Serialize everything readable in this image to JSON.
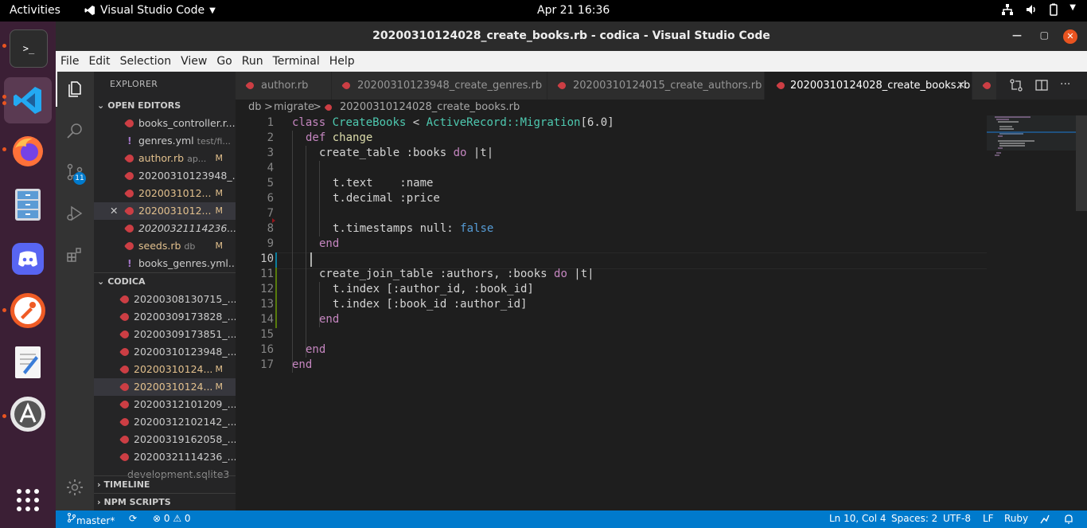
{
  "topbar": {
    "activities": "Activities",
    "app_name": "Visual Studio Code",
    "clock": "Apr 21  16:36"
  },
  "window": {
    "title": "20200310124028_create_books.rb - codica - Visual Studio Code"
  },
  "menu": [
    "File",
    "Edit",
    "Selection",
    "View",
    "Go",
    "Run",
    "Terminal",
    "Help"
  ],
  "activity": {
    "scm_badge": "11"
  },
  "sidebar": {
    "title": "EXPLORER",
    "open_editors_header": "OPEN EDITORS",
    "open_editors": [
      {
        "name": "books_controller.r...",
        "desc": "",
        "mod": "",
        "icon": "ruby",
        "style": ""
      },
      {
        "name": "genres.yml",
        "desc": "test/fi...",
        "mod": "",
        "icon": "yml",
        "style": ""
      },
      {
        "name": "author.rb",
        "desc": "ap...",
        "mod": "M",
        "icon": "ruby",
        "style": "mod"
      },
      {
        "name": "20200310123948_...",
        "desc": "",
        "mod": "",
        "icon": "ruby",
        "style": ""
      },
      {
        "name": "2020031012...",
        "desc": "",
        "mod": "M",
        "icon": "ruby",
        "style": "mod"
      },
      {
        "name": "2020031012...",
        "desc": "",
        "mod": "M",
        "icon": "ruby",
        "style": "mod",
        "selected": true,
        "close": "✕"
      },
      {
        "name": "20200321114236...",
        "desc": "",
        "mod": "",
        "icon": "ruby",
        "style": "ital"
      },
      {
        "name": "seeds.rb",
        "desc": "db",
        "mod": "M",
        "icon": "ruby",
        "style": "mod"
      },
      {
        "name": "books_genres.yml...",
        "desc": "",
        "mod": "",
        "icon": "yml",
        "style": ""
      }
    ],
    "codica_header": "CODICA",
    "codica_files": [
      {
        "name": "20200308130715_...",
        "mod": "",
        "style": ""
      },
      {
        "name": "20200309173828_...",
        "mod": "",
        "style": ""
      },
      {
        "name": "20200309173851_...",
        "mod": "",
        "style": ""
      },
      {
        "name": "20200310123948_...",
        "mod": "",
        "style": ""
      },
      {
        "name": "20200310124...",
        "mod": "M",
        "style": "mod"
      },
      {
        "name": "20200310124...",
        "mod": "M",
        "style": "mod",
        "selected": true
      },
      {
        "name": "20200312101209_...",
        "mod": "",
        "style": ""
      },
      {
        "name": "20200312102142_...",
        "mod": "",
        "style": ""
      },
      {
        "name": "20200319162058_...",
        "mod": "",
        "style": ""
      },
      {
        "name": "20200321114236_...",
        "mod": "",
        "style": ""
      },
      {
        "name": "development.sqlite3",
        "mod": "",
        "style": "dimmed"
      }
    ],
    "timeline_header": "TIMELINE",
    "npm_header": "NPM SCRIPTS"
  },
  "tabs": [
    {
      "label": "author.rb",
      "active": false
    },
    {
      "label": "20200310123948_create_genres.rb",
      "active": false
    },
    {
      "label": "20200310124015_create_authors.rb",
      "active": false
    },
    {
      "label": "20200310124028_create_books.rb",
      "active": true,
      "close": "✕"
    }
  ],
  "breadcrumb": {
    "parts": [
      "db",
      "migrate",
      "20200310124028_create_books.rb"
    ],
    "sep": ">"
  },
  "editor": {
    "current_line": 10,
    "lines": [
      "1",
      "2",
      "3",
      "4",
      "5",
      "6",
      "7",
      "8",
      "9",
      "10",
      "11",
      "12",
      "13",
      "14",
      "15",
      "16",
      "17"
    ],
    "code": {
      "l1_kw": "class",
      "l1_cls": "CreateBooks",
      "l1_op": " < ",
      "l1_cls2": "ActiveRecord::Migration",
      "l1_num": "[6.0]",
      "l2_kw": "def",
      "l2_name": " change",
      "l3_a": "create_table :books ",
      "l3_kw": "do",
      "l3_b": " |t|",
      "l5": "t.text    :name",
      "l6": "t.decimal :price",
      "l8_a": "t.timestamps null: ",
      "l8_bool": "false",
      "l9_kw": "end",
      "l11_a": "create_join_table :authors, :books ",
      "l11_kw": "do",
      "l11_b": " |t|",
      "l12": "t.index [:author_id, :book_id]",
      "l13": "t.index [:book_id :author_id]",
      "l14_kw": "end",
      "l16_kw": "end",
      "l17_kw": "end"
    }
  },
  "status": {
    "branch": "master*",
    "sync": "⟳",
    "problems": "⊗ 0 ⚠ 0",
    "position": "Ln 10, Col 4",
    "spaces": "Spaces: 2",
    "encoding": "UTF-8",
    "eol": "LF",
    "language": "Ruby"
  },
  "colors": {
    "statusbar": "#007acc",
    "ruby_icon": "#cc3e44",
    "modified": "#e2c08d",
    "ubuntu_orange": "#e95420"
  }
}
